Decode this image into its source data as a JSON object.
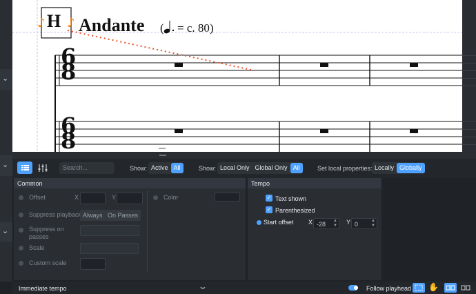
{
  "score": {
    "rehearsal_mark": "H",
    "tempo_text": "Andante",
    "tempo_marking": "= c. 80)",
    "tempo_paren": "(",
    "time_sig_top": "6",
    "time_sig_bottom": "8"
  },
  "toolbar": {
    "search_placeholder": "Search...",
    "show1_label": "Show:",
    "show1_options": [
      "Active",
      "All"
    ],
    "show2_label": "Show:",
    "show2_options": [
      "Local Only",
      "Global Only",
      "All"
    ],
    "set_local_label": "Set local properties:",
    "set_local_options": [
      "Locally",
      "Globally"
    ]
  },
  "common": {
    "title": "Common",
    "offset_label": "Offset",
    "x_label": "X",
    "y_label": "Y",
    "color_label": "Color",
    "suppress_playback_label": "Suppress playback",
    "always_label": "Always",
    "on_passes_label": "On Passes",
    "suppress_on_passes_label": "Suppress on passes",
    "scale_label": "Scale",
    "custom_scale_label": "Custom scale"
  },
  "tempo": {
    "title": "Tempo",
    "text_shown_label": "Text shown",
    "parenthesized_label": "Parenthesized",
    "start_offset_label": "Start offset",
    "x_label": "X",
    "x_value": "-28",
    "y_label": "Y",
    "y_value": "0"
  },
  "status": {
    "left_text": "Immediate tempo",
    "follow_playhead_label": "Follow playhead"
  },
  "colors": {
    "accent": "#4fa1ff",
    "rehearsal_glow": "#f28a1f",
    "drag_line": "#e8502a"
  }
}
